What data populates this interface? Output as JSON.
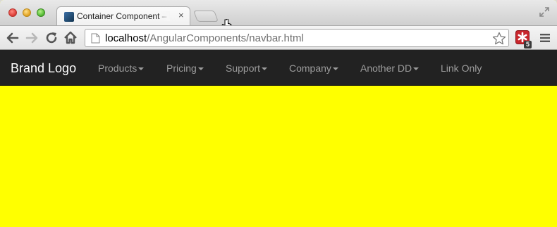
{
  "browser": {
    "tab": {
      "title": "Container Component – Na",
      "close": "×"
    },
    "address": {
      "host": "localhost",
      "path": "/AngularComponents/navbar.html"
    },
    "extension_badge": "5"
  },
  "navbar": {
    "brand": "Brand Logo",
    "items": [
      {
        "label": "Products",
        "dropdown": true
      },
      {
        "label": "Pricing",
        "dropdown": true
      },
      {
        "label": "Support",
        "dropdown": true
      },
      {
        "label": "Company",
        "dropdown": true
      },
      {
        "label": "Another DD",
        "dropdown": true
      },
      {
        "label": "Link Only",
        "dropdown": false
      }
    ]
  },
  "colors": {
    "navbar_bg": "#222222",
    "nav_text": "#9d9d9d",
    "brand_text": "#ffffff",
    "content_bg": "#ffff00"
  },
  "icons": [
    "back-icon",
    "forward-icon",
    "reload-icon",
    "home-icon",
    "page-icon",
    "star-icon",
    "extension-icon",
    "menu-icon",
    "fullscreen-icon",
    "cursor-icon"
  ]
}
